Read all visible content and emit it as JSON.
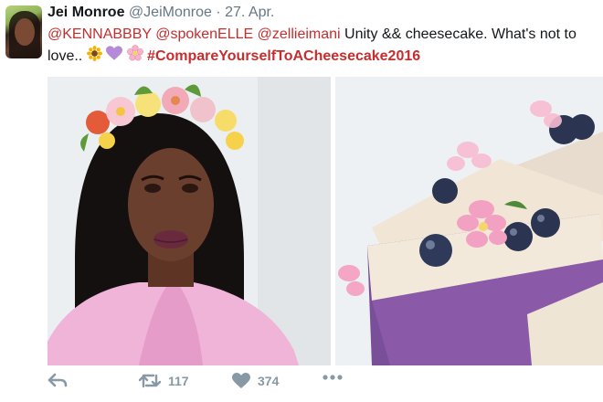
{
  "tweet": {
    "author_name": "Jei Monroe",
    "author_handle": "@JeiMonroe",
    "separator": "·",
    "date": "27. Apr.",
    "mentions": [
      "@KENNABBBY",
      "@spokenELLE",
      "@zellieimani"
    ],
    "text_part1": " Unity && cheesecake. What's not to",
    "text_line2": "love.. ",
    "emojis": [
      "sunflower-emoji",
      "purple-heart-emoji",
      "cherry-blossom-emoji"
    ],
    "hashtag": "#CompareYourselfToACheesecake2016"
  },
  "media": {
    "left_photo": "selfie-with-flower-crown-photo",
    "right_photo": "purple-cheesecake-with-blueberries-photo"
  },
  "actions": {
    "retweet_count": "117",
    "like_count": "374"
  },
  "colors": {
    "link": "#c62e2e",
    "muted": "#657786",
    "icon": "#8899a6"
  }
}
